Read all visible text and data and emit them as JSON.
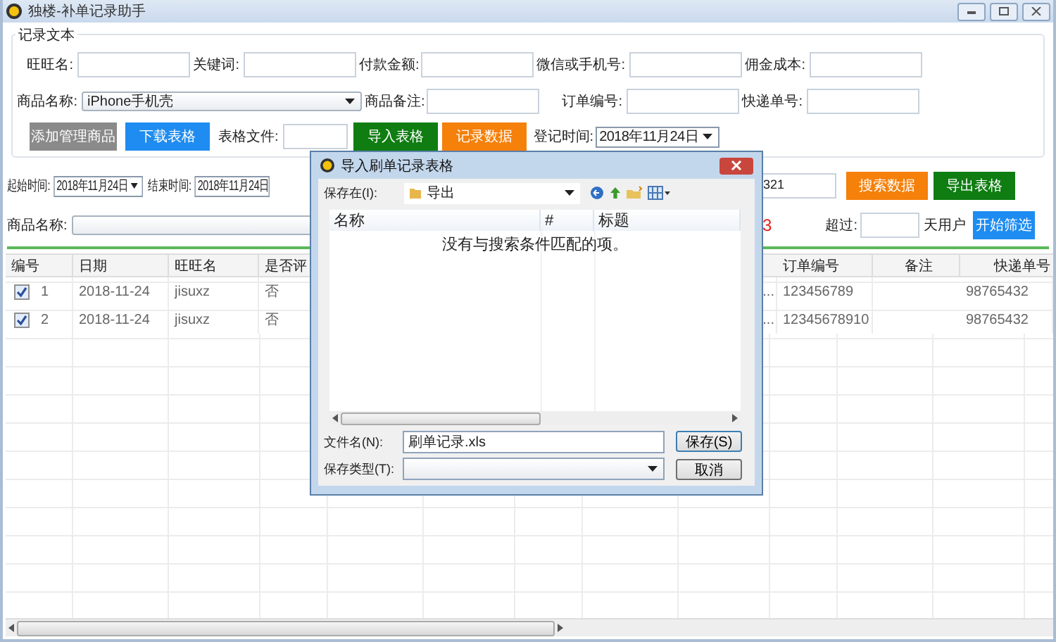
{
  "window": {
    "title": "独楼-补单记录助手"
  },
  "record_group": {
    "title": "记录文本",
    "row1": [
      {
        "label": "旺旺名:"
      },
      {
        "label": "关键词:"
      },
      {
        "label": "付款金额:"
      },
      {
        "label": "微信或手机号:"
      },
      {
        "label": "佣金成本:"
      }
    ],
    "product": {
      "label": "商品名称:",
      "value": "iPhone手机壳"
    },
    "row2": [
      {
        "label": "商品备注:"
      },
      {
        "label": "订单编号:"
      },
      {
        "label": "快递单号:"
      }
    ],
    "add_button": "添加管理商品",
    "download_button": "下载表格",
    "file_label": "表格文件:",
    "import_button": "导入表格",
    "record_button": "记录数据",
    "reg_time": {
      "label": "登记时间:",
      "value": "2018年11月24日"
    }
  },
  "search": {
    "start": {
      "label": "起始时间:",
      "value": "2018年11月24日"
    },
    "end": {
      "label": "结束时间:",
      "value": "2018年11月24日"
    },
    "field_value": "321",
    "search_button": "搜索数据",
    "export_button": "导出表格",
    "product_label": "商品名称:",
    "count": "3",
    "over_label": "超过:",
    "days_label": "天用户",
    "filter_button": "开始筛选"
  },
  "table": {
    "columns": [
      "编号",
      "日期",
      "旺旺名",
      "是否评",
      "订单编号",
      "备注",
      "快递单号"
    ],
    "rows": [
      {
        "checked": true,
        "no": "1",
        "date": "2018-11-24",
        "wangwang": "jisuxz",
        "reviewed": "否",
        "column_5": "...",
        "order_no": "123456789",
        "express_no": "98765432"
      },
      {
        "checked": true,
        "no": "2",
        "date": "2018-11-24",
        "wangwang": "jisuxz",
        "reviewed": "否",
        "column_5": "...",
        "order_no": "12345678910",
        "express_no": "98765432"
      }
    ]
  },
  "dialog": {
    "title": "导入刷单记录表格",
    "save_in_label": "保存在(I):",
    "location": "导出",
    "columns": [
      "名称",
      "#",
      "标题"
    ],
    "empty_message": "没有与搜索条件匹配的项。",
    "filename_label": "文件名(N):",
    "filename": "刷单记录.xls",
    "type_label": "保存类型(T):",
    "save_button": "保存(S)",
    "cancel_button": "取消"
  }
}
